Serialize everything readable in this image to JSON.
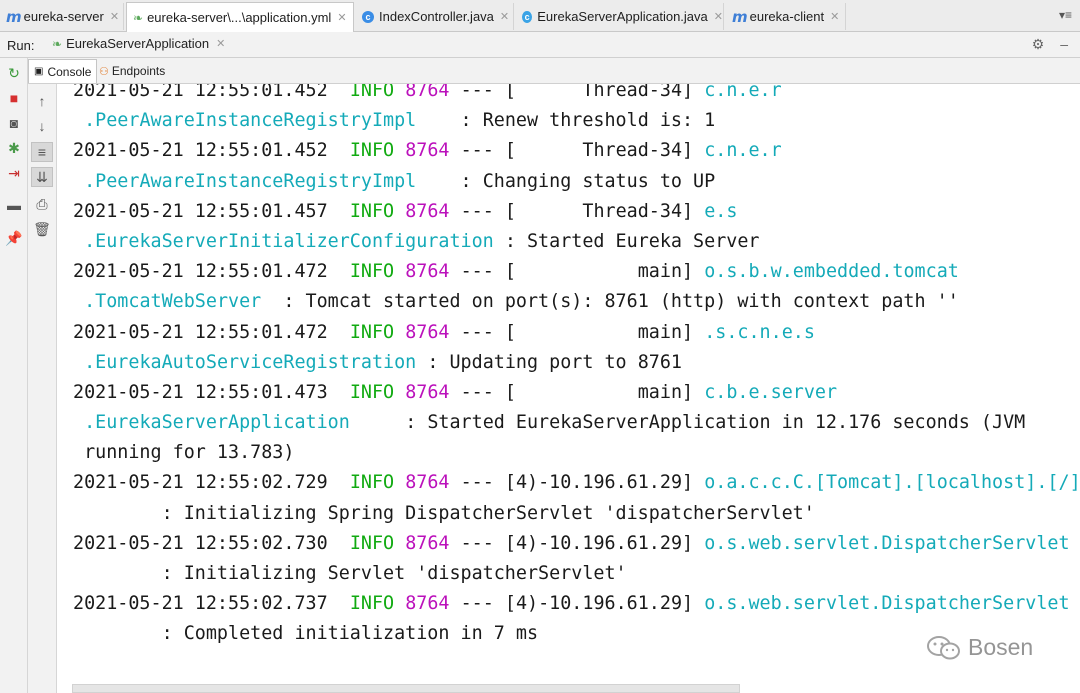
{
  "editor_tabs": [
    {
      "label": "eureka-server",
      "icon": "module-icon"
    },
    {
      "label": "eureka-server\\...\\application.yml",
      "icon": "yml-leaf-icon"
    },
    {
      "label": "IndexController.java",
      "icon": "class-icon"
    },
    {
      "label": "EurekaServerApplication.java",
      "icon": "class-icon"
    },
    {
      "label": "eureka-client",
      "icon": "module-icon"
    }
  ],
  "editor_overflow": "▾≡",
  "run_bar": {
    "label": "Run:",
    "config_name": "EurekaServerApplication"
  },
  "sub_tabs": {
    "console": "Console",
    "endpoints": "Endpoints"
  },
  "log": {
    "lines": [
      {
        "ts": "2021-05-21 12:55:01.452",
        "level": "INFO",
        "pid": "8764",
        "sep": "---",
        "thread": "[      Thread-34]",
        "logger": "c.n.e.r"
      },
      {
        "cont_logger": ".PeerAwareInstanceRegistryImpl",
        "pad": "    ",
        "msg": ": Renew threshold is: 1"
      },
      {
        "ts": "2021-05-21 12:55:01.452",
        "level": "INFO",
        "pid": "8764",
        "sep": "---",
        "thread": "[      Thread-34]",
        "logger": "c.n.e.r"
      },
      {
        "cont_logger": ".PeerAwareInstanceRegistryImpl",
        "pad": "    ",
        "msg": ": Changing status to UP"
      },
      {
        "ts": "2021-05-21 12:55:01.457",
        "level": "INFO",
        "pid": "8764",
        "sep": "---",
        "thread": "[      Thread-34]",
        "logger": "e.s"
      },
      {
        "cont_logger": ".EurekaServerInitializerConfiguration",
        "pad": " ",
        "msg": ": Started Eureka Server"
      },
      {
        "ts": "2021-05-21 12:55:01.472",
        "level": "INFO",
        "pid": "8764",
        "sep": "---",
        "thread": "[           main]",
        "logger": "o.s.b.w.embedded.tomcat"
      },
      {
        "cont_logger": ".TomcatWebServer",
        "pad": "  ",
        "msg": ": Tomcat started on port(s): 8761 (http) with context path ''"
      },
      {
        "ts": "2021-05-21 12:55:01.472",
        "level": "INFO",
        "pid": "8764",
        "sep": "---",
        "thread": "[           main]",
        "logger": ".s.c.n.e.s"
      },
      {
        "cont_logger": ".EurekaAutoServiceRegistration",
        "pad": " ",
        "msg": ": Updating port to 8761"
      },
      {
        "ts": "2021-05-21 12:55:01.473",
        "level": "INFO",
        "pid": "8764",
        "sep": "---",
        "thread": "[           main]",
        "logger": "c.b.e.server"
      },
      {
        "cont_logger": ".EurekaServerApplication",
        "pad": "     ",
        "msg": ": Started EurekaServerApplication in 12.176 seconds (JVM"
      },
      {
        "plain": " running for 13.783)"
      },
      {
        "ts": "2021-05-21 12:55:02.729",
        "level": "INFO",
        "pid": "8764",
        "sep": "---",
        "thread": "[4)-10.196.61.29]",
        "logger": "o.a.c.c.C.[Tomcat].[localhost].[/]"
      },
      {
        "plain": "        : Initializing Spring DispatcherServlet 'dispatcherServlet'"
      },
      {
        "ts": "2021-05-21 12:55:02.730",
        "level": "INFO",
        "pid": "8764",
        "sep": "---",
        "thread": "[4)-10.196.61.29]",
        "logger": "o.s.web.servlet.DispatcherServlet"
      },
      {
        "plain": "        : Initializing Servlet 'dispatcherServlet'"
      },
      {
        "ts": "2021-05-21 12:55:02.737",
        "level": "INFO",
        "pid": "8764",
        "sep": "---",
        "thread": "[4)-10.196.61.29]",
        "logger": "o.s.web.servlet.DispatcherServlet"
      },
      {
        "plain": "        : Completed initialization in 7 ms"
      }
    ]
  },
  "watermark": "Bosen",
  "colors": {
    "info": "#11aa11",
    "pid": "#bb11bb",
    "logger": "#14aab8"
  }
}
